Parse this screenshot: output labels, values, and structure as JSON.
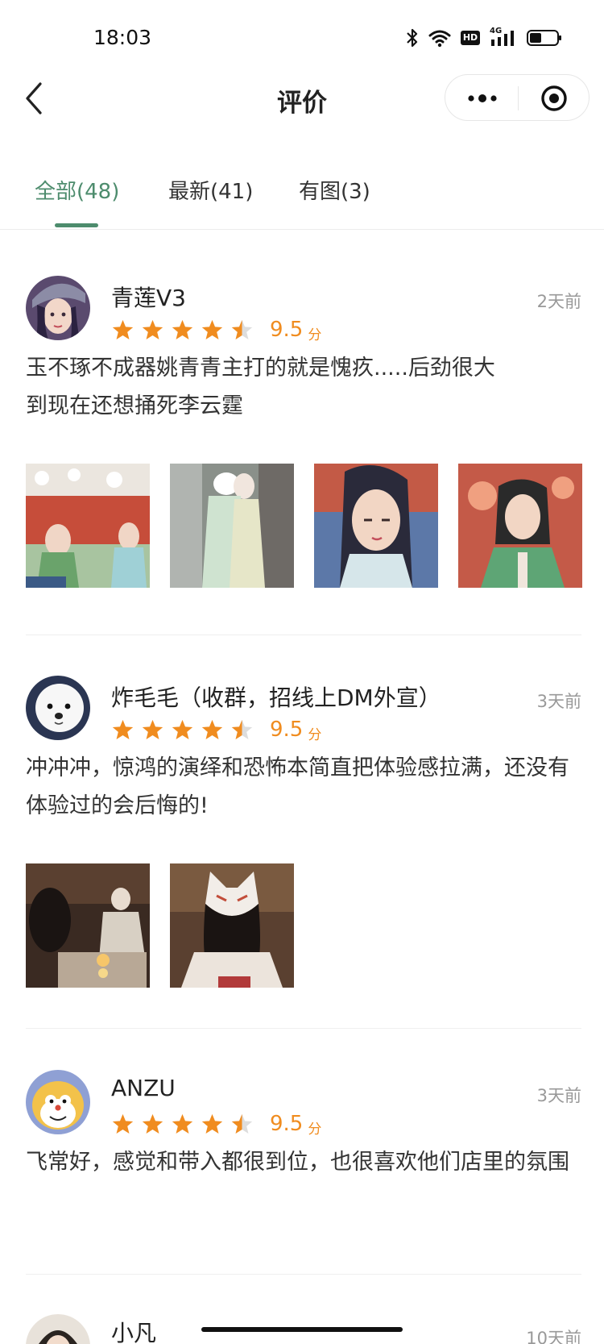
{
  "status": {
    "time": "18:03",
    "network": "4G",
    "hd": "HD"
  },
  "nav": {
    "title": "评价",
    "back_icon": "chevron-left-icon",
    "more_icon": "more-dots-icon",
    "close_icon": "record-close-icon"
  },
  "tabs": [
    {
      "label": "全部(48)",
      "active": true
    },
    {
      "label": "最新(41)",
      "active": false
    },
    {
      "label": "有图(3)",
      "active": false
    }
  ],
  "colors": {
    "accent": "#4d8c6d",
    "star": "#f08c1f",
    "star_empty": "#dddddd",
    "muted": "#999999"
  },
  "reviews": [
    {
      "name": "青莲V3",
      "date": "2天前",
      "rating": 4.5,
      "score": "9.5",
      "unit": "分",
      "text": "玉不琢不成器姚青青主打的就是愧疚.....后劲很大\n到现在还想捅死李云霆",
      "photos": 4
    },
    {
      "name": "炸毛毛（收群，招线上DM外宣）",
      "date": "3天前",
      "rating": 4.5,
      "score": "9.5",
      "unit": "分",
      "text": "冲冲冲，惊鸿的演绎和恐怖本简直把体验感拉满，还没有体验过的会后悔的!",
      "photos": 2
    },
    {
      "name": "ANZU",
      "date": "3天前",
      "rating": 4.5,
      "score": "9.5",
      "unit": "分",
      "text": "飞常好，感觉和带入都很到位，也很喜欢他们店里的氛围",
      "photos": 0
    },
    {
      "name": "小凡",
      "date": "10天前"
    }
  ]
}
